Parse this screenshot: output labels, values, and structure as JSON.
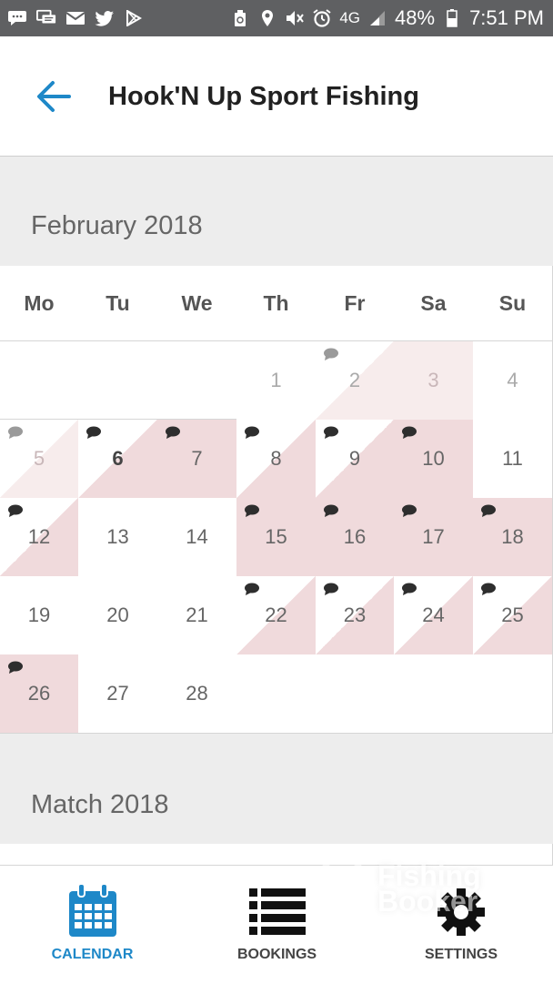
{
  "status_bar": {
    "battery": "48%",
    "time": "7:51 PM",
    "network": "4G",
    "left_icons": [
      "message-icon",
      "chat-icon",
      "mail-icon",
      "twitter-icon",
      "play-store-icon"
    ],
    "right_icons": [
      "recycle-icon",
      "location-icon",
      "mute-icon",
      "alarm-icon",
      "signal-icon",
      "battery-icon"
    ]
  },
  "header": {
    "title": "Hook'N Up Sport Fishing",
    "back_icon": "back-arrow-icon"
  },
  "colors": {
    "accent": "#1e88c8",
    "booked_pink": "#f0dadc",
    "faded_pink": "#f7ecec",
    "grid_line": "#d6d6d6",
    "background": "#ededed"
  },
  "weekdays": [
    "Mo",
    "Tu",
    "We",
    "Th",
    "Fr",
    "Sa",
    "Su"
  ],
  "months": [
    {
      "label": "February 2018",
      "days": [
        {
          "day": "1",
          "col": 3,
          "row": 0,
          "style": "muted",
          "fill": "none",
          "note": "none"
        },
        {
          "day": "2",
          "col": 4,
          "row": 0,
          "style": "muted",
          "fill": "diag-faded",
          "note": "grey"
        },
        {
          "day": "3",
          "col": 5,
          "row": 0,
          "style": "faint",
          "fill": "full-faded",
          "note": "none"
        },
        {
          "day": "4",
          "col": 6,
          "row": 0,
          "style": "muted",
          "fill": "none",
          "note": "none"
        },
        {
          "day": "5",
          "col": 0,
          "row": 1,
          "style": "faint",
          "fill": "diag-faded",
          "note": "grey"
        },
        {
          "day": "6",
          "col": 1,
          "row": 1,
          "style": "bold",
          "fill": "diag",
          "note": "dark"
        },
        {
          "day": "7",
          "col": 2,
          "row": 1,
          "style": "normal",
          "fill": "full",
          "note": "dark"
        },
        {
          "day": "8",
          "col": 3,
          "row": 1,
          "style": "normal",
          "fill": "diag",
          "note": "dark"
        },
        {
          "day": "9",
          "col": 4,
          "row": 1,
          "style": "normal",
          "fill": "diag",
          "note": "dark"
        },
        {
          "day": "10",
          "col": 5,
          "row": 1,
          "style": "normal",
          "fill": "full",
          "note": "dark"
        },
        {
          "day": "11",
          "col": 6,
          "row": 1,
          "style": "normal",
          "fill": "none",
          "note": "none"
        },
        {
          "day": "12",
          "col": 0,
          "row": 2,
          "style": "normal",
          "fill": "diag",
          "note": "dark"
        },
        {
          "day": "13",
          "col": 1,
          "row": 2,
          "style": "normal",
          "fill": "none",
          "note": "none"
        },
        {
          "day": "14",
          "col": 2,
          "row": 2,
          "style": "normal",
          "fill": "none",
          "note": "none"
        },
        {
          "day": "15",
          "col": 3,
          "row": 2,
          "style": "normal",
          "fill": "full",
          "note": "dark"
        },
        {
          "day": "16",
          "col": 4,
          "row": 2,
          "style": "normal",
          "fill": "full",
          "note": "dark"
        },
        {
          "day": "17",
          "col": 5,
          "row": 2,
          "style": "normal",
          "fill": "full",
          "note": "dark"
        },
        {
          "day": "18",
          "col": 6,
          "row": 2,
          "style": "normal",
          "fill": "full",
          "note": "dark"
        },
        {
          "day": "19",
          "col": 0,
          "row": 3,
          "style": "normal",
          "fill": "none",
          "note": "none"
        },
        {
          "day": "20",
          "col": 1,
          "row": 3,
          "style": "normal",
          "fill": "none",
          "note": "none"
        },
        {
          "day": "21",
          "col": 2,
          "row": 3,
          "style": "normal",
          "fill": "none",
          "note": "none"
        },
        {
          "day": "22",
          "col": 3,
          "row": 3,
          "style": "normal",
          "fill": "diag",
          "note": "dark"
        },
        {
          "day": "23",
          "col": 4,
          "row": 3,
          "style": "normal",
          "fill": "diag",
          "note": "dark"
        },
        {
          "day": "24",
          "col": 5,
          "row": 3,
          "style": "normal",
          "fill": "diag",
          "note": "dark"
        },
        {
          "day": "25",
          "col": 6,
          "row": 3,
          "style": "normal",
          "fill": "diag",
          "note": "dark"
        },
        {
          "day": "26",
          "col": 0,
          "row": 4,
          "style": "normal",
          "fill": "full",
          "note": "dark"
        },
        {
          "day": "27",
          "col": 1,
          "row": 4,
          "style": "normal",
          "fill": "none",
          "note": "none"
        },
        {
          "day": "28",
          "col": 2,
          "row": 4,
          "style": "normal",
          "fill": "none",
          "note": "none"
        }
      ]
    },
    {
      "label": "Match 2018"
    }
  ],
  "bottom_nav": [
    {
      "label": "CALENDAR",
      "icon": "calendar-icon",
      "active": true
    },
    {
      "label": "BOOKINGS",
      "icon": "list-icon",
      "active": false
    },
    {
      "label": "SETTINGS",
      "icon": "gear-icon",
      "active": false
    }
  ],
  "watermark": {
    "line1": "Fishing",
    "line2": "Booker"
  }
}
